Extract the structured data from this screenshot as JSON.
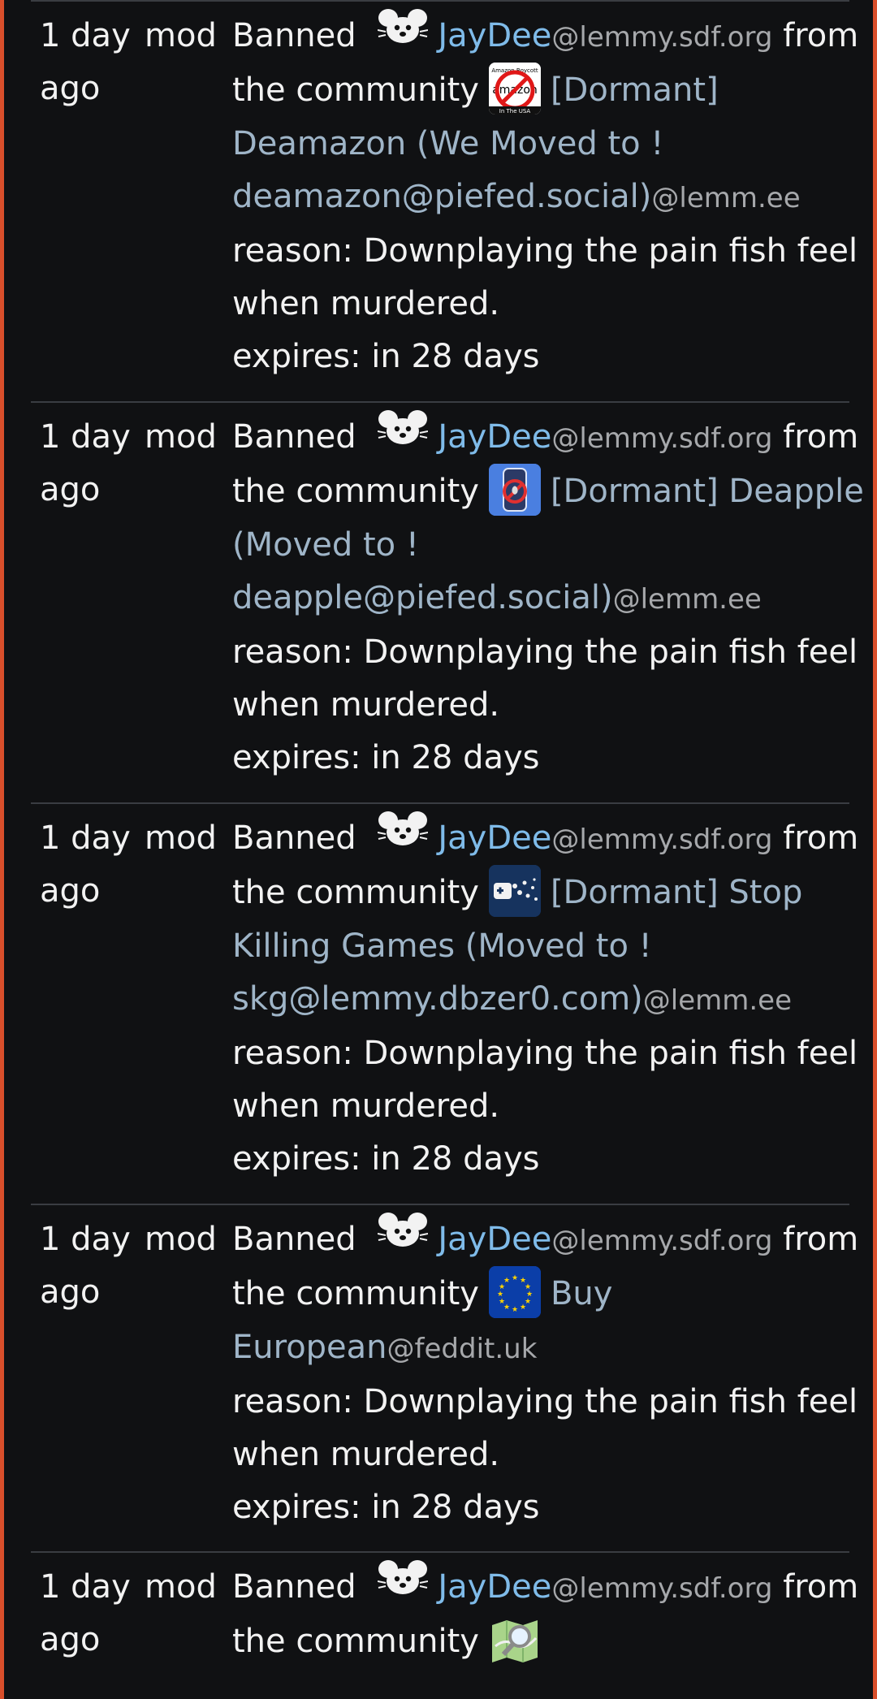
{
  "entries": [
    {
      "time_line1": "1 day",
      "time_line2": "ago",
      "actor": "mod",
      "banned": "Banned",
      "user": "JayDee",
      "user_host": "@lemmy.sdf.org",
      "from": "from",
      "the_community": "the community",
      "community_lines": [
        "[Dormant]",
        "Deamazon (We Moved to !",
        "deamazon@piefed.social)"
      ],
      "community_host": "@lemm.ee",
      "reason_line1": "reason: Downplaying the pain fish feel",
      "reason_line2": "when murdered.",
      "expires": "expires: in 28 days",
      "icon": "deamazon-icon"
    },
    {
      "time_line1": "1 day",
      "time_line2": "ago",
      "actor": "mod",
      "banned": "Banned",
      "user": "JayDee",
      "user_host": "@lemmy.sdf.org",
      "from": "from",
      "the_community": "the community",
      "community_lines": [
        "[Dormant] Deapple",
        "(Moved to !",
        "deapple@piefed.social)"
      ],
      "community_host": "@lemm.ee",
      "reason_line1": "reason: Downplaying the pain fish feel",
      "reason_line2": "when murdered.",
      "expires": "expires: in 28 days",
      "icon": "deapple-icon"
    },
    {
      "time_line1": "1 day",
      "time_line2": "ago",
      "actor": "mod",
      "banned": "Banned",
      "user": "JayDee",
      "user_host": "@lemmy.sdf.org",
      "from": "from",
      "the_community": "the community",
      "community_lines": [
        "[Dormant] Stop",
        "Killing Games (Moved to !",
        "skg@lemmy.dbzer0.com)"
      ],
      "community_host": "@lemm.ee",
      "reason_line1": "reason: Downplaying the pain fish feel",
      "reason_line2": "when murdered.",
      "expires": "expires: in 28 days",
      "icon": "stop-killing-games-icon"
    },
    {
      "time_line1": "1 day",
      "time_line2": "ago",
      "actor": "mod",
      "banned": "Banned",
      "user": "JayDee",
      "user_host": "@lemmy.sdf.org",
      "from": "from",
      "the_community": "the community",
      "community_lines": [
        "Buy",
        "European"
      ],
      "community_host": "@feddit.uk",
      "reason_line1": "reason: Downplaying the pain fish feel",
      "reason_line2": "when murdered.",
      "expires": "expires: in 28 days",
      "icon": "eu-flag-icon"
    },
    {
      "time_line1": "1 day",
      "time_line2": "ago",
      "actor": "mod",
      "banned": "Banned",
      "user": "JayDee",
      "user_host": "@lemmy.sdf.org",
      "from": "from",
      "the_community": "the community",
      "icon": "map-search-icon"
    }
  ],
  "colors": {
    "background": "#101113",
    "border_accent": "#d94f2b",
    "link": "#7fbbe9",
    "host": "#a6a8ab",
    "text": "#f2f2f2",
    "divider": "#3a3d42"
  }
}
